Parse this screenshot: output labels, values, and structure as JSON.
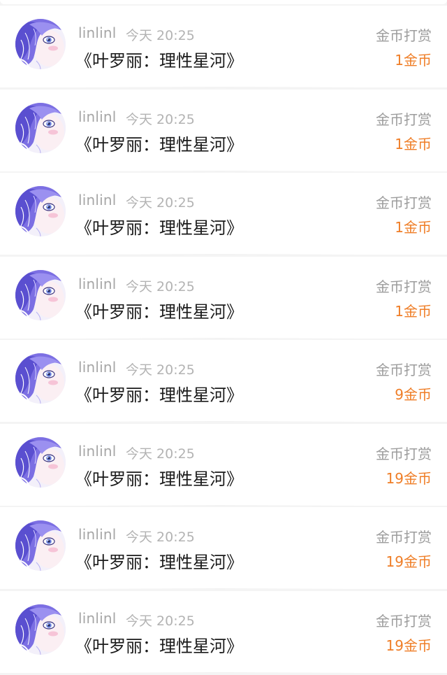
{
  "avatar_icon": "anime-character-avatar",
  "accent_color": "#ef7d26",
  "records": [
    {
      "username": "linlinl",
      "time": "今天 20:25",
      "title": "《叶罗丽：理性星河》",
      "type": "金币打赏",
      "amount": "1金币"
    },
    {
      "username": "linlinl",
      "time": "今天 20:25",
      "title": "《叶罗丽：理性星河》",
      "type": "金币打赏",
      "amount": "1金币"
    },
    {
      "username": "linlinl",
      "time": "今天 20:25",
      "title": "《叶罗丽：理性星河》",
      "type": "金币打赏",
      "amount": "1金币"
    },
    {
      "username": "linlinl",
      "time": "今天 20:25",
      "title": "《叶罗丽：理性星河》",
      "type": "金币打赏",
      "amount": "1金币"
    },
    {
      "username": "linlinl",
      "time": "今天 20:25",
      "title": "《叶罗丽：理性星河》",
      "type": "金币打赏",
      "amount": "9金币"
    },
    {
      "username": "linlinl",
      "time": "今天 20:25",
      "title": "《叶罗丽：理性星河》",
      "type": "金币打赏",
      "amount": "19金币"
    },
    {
      "username": "linlinl",
      "time": "今天 20:25",
      "title": "《叶罗丽：理性星河》",
      "type": "金币打赏",
      "amount": "19金币"
    },
    {
      "username": "linlinl",
      "time": "今天 20:25",
      "title": "《叶罗丽：理性星河》",
      "type": "金币打赏",
      "amount": "19金币"
    }
  ]
}
